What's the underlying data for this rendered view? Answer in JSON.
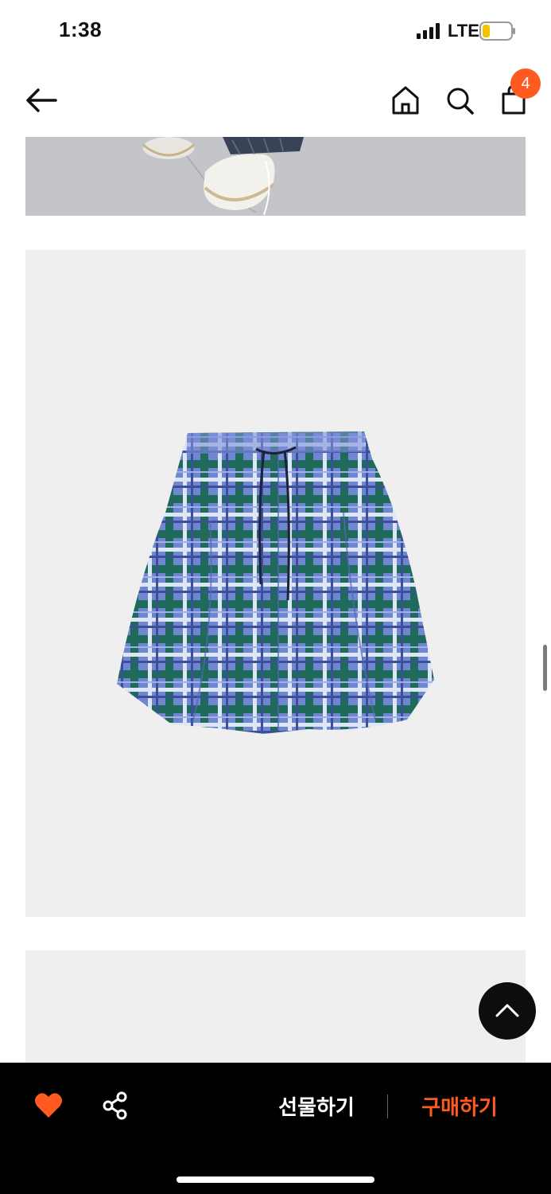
{
  "status_bar": {
    "time": "1:38",
    "network": "LTE",
    "battery_color": "#f5c400"
  },
  "header": {
    "back_icon": "arrow-left-icon",
    "home_icon": "home-icon",
    "search_icon": "search-icon",
    "cart_icon": "shopping-bag-icon",
    "cart_count": "4",
    "badge_color": "#ff5a1f"
  },
  "content": {
    "images": [
      {
        "subject": "model feet with white sneakers on grey floor"
      },
      {
        "subject": "blue and green plaid flared mini skirt with drawstring"
      },
      {
        "subject": "next product photo"
      }
    ]
  },
  "scroll_top_icon": "chevron-up-icon",
  "bottom_bar": {
    "like_icon": "heart-icon",
    "share_icon": "share-icon",
    "gift_label": "선물하기",
    "buy_label": "구매하기",
    "accent_color": "#ff5a1f"
  }
}
